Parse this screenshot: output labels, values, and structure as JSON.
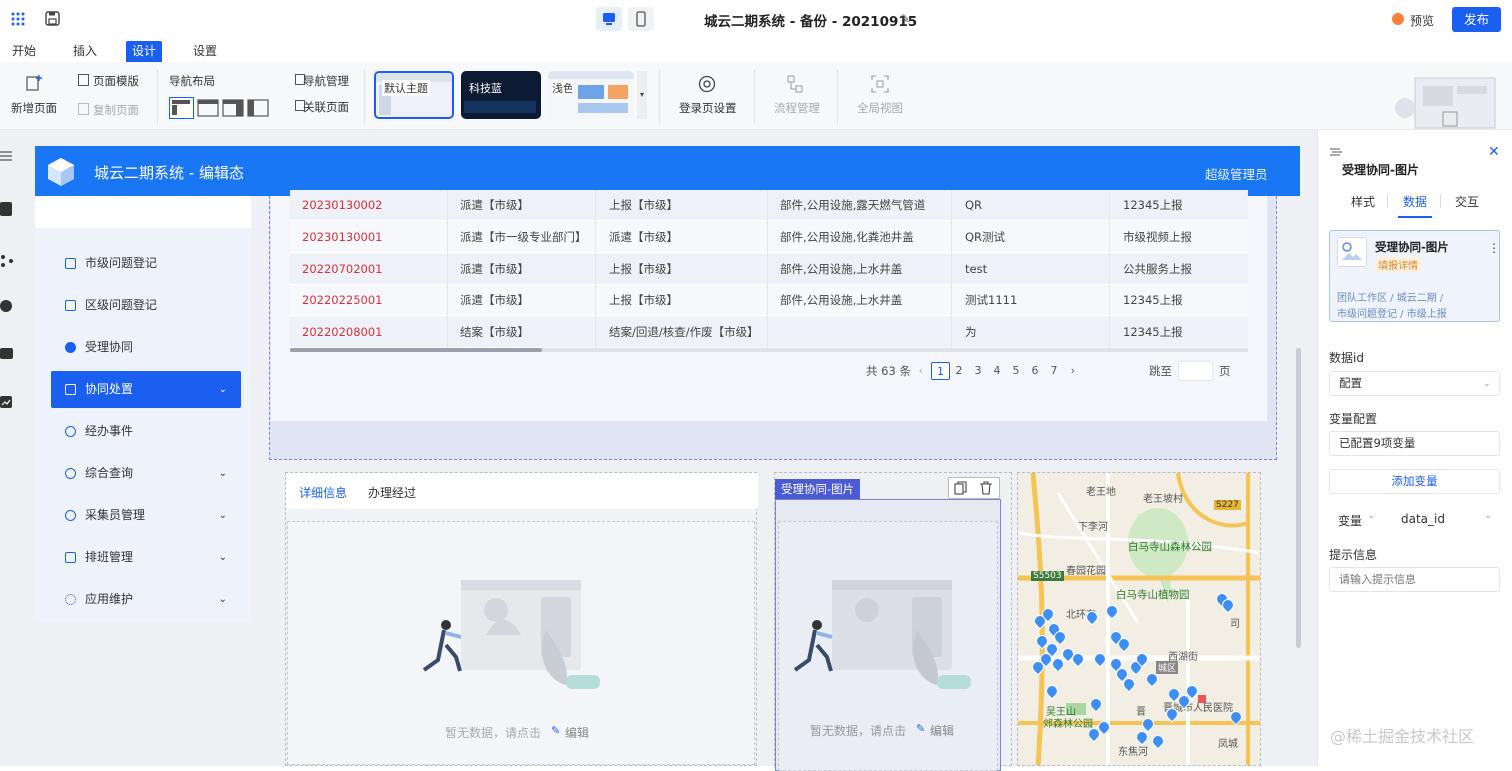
{
  "window": {
    "title": "城云二期系统 - 备份 - 20210915",
    "preview_label": "预览",
    "publish_label": "发布"
  },
  "menu": [
    "开始",
    "插入",
    "设计",
    "设置"
  ],
  "ribbon": {
    "new_page": "新增页面",
    "page_template": "页面模版",
    "copy_page": "复制页面",
    "nav_layout": "导航布局",
    "nav_manage": "导航管理",
    "linked_page": "关联页面",
    "themes": [
      "默认主题",
      "科技蓝",
      "浅色"
    ],
    "login_setting": "登录页设置",
    "flow_manage": "流程管理",
    "global_view": "全局视图"
  },
  "app": {
    "title": "城云二期系统 - 编辑态",
    "user": "超级管理员"
  },
  "nav": [
    {
      "label": "市级问题登记",
      "chev": ""
    },
    {
      "label": "区级问题登记",
      "chev": ""
    },
    {
      "label": "受理协同",
      "chev": ""
    },
    {
      "label": "协同处置",
      "chev": "⌄"
    },
    {
      "label": "经办事件",
      "chev": ""
    },
    {
      "label": "综合查询",
      "chev": "⌄"
    },
    {
      "label": "采集员管理",
      "chev": "⌄"
    },
    {
      "label": "排班管理",
      "chev": "⌄"
    },
    {
      "label": "应用维护",
      "chev": "⌄"
    }
  ],
  "table": {
    "rows": [
      [
        "20230130002",
        "派遣【市级】",
        "上报【市级】",
        "部件,公用设施,露天燃气管道",
        "QR",
        "12345上报"
      ],
      [
        "20230130001",
        "派遣【市一级专业部门】",
        "派遣【市级】",
        "部件,公用设施,化粪池井盖",
        "QR测试",
        "市级视频上报"
      ],
      [
        "20220702001",
        "派遣【市级】",
        "上报【市级】",
        "部件,公用设施,上水井盖",
        "test",
        "公共服务上报"
      ],
      [
        "20220225001",
        "派遣【市级】",
        "上报【市级】",
        "部件,公用设施,上水井盖",
        "测试1111",
        "12345上报"
      ],
      [
        "20220208001",
        "结案【市级】",
        "结案/回退/核查/作废【市级】",
        "",
        "为",
        "12345上报"
      ]
    ]
  },
  "pagination": {
    "total": "共 63 条",
    "pages": [
      "1",
      "2",
      "3",
      "4",
      "5",
      "6",
      "7"
    ],
    "current": "1",
    "goto": "跳至",
    "page_unit": "页",
    "prev": "‹",
    "next": "›"
  },
  "detail": {
    "tabs": [
      "详细信息",
      "办理经过"
    ],
    "empty": "暂无数据，请点击",
    "edit": "编辑"
  },
  "image_component": {
    "label": "受理协同-图片",
    "empty": "暂无数据，请点击",
    "edit": "编辑"
  },
  "map": {
    "labels": [
      "老王地",
      "老王坡村",
      "下李河",
      "白马寺山森林公园",
      "S227",
      "S5503",
      "春园花园",
      "白马寺山植物园",
      "北环东",
      "西湖街",
      "城区",
      "吴王山",
      "郊森林公园",
      "晋城市人民医院",
      "晋",
      "司",
      "东焦河",
      "凤城"
    ]
  },
  "right_panel": {
    "title": "受理协同-图片",
    "tabs": [
      "样式",
      "数据",
      "交互"
    ],
    "active_tab": "数据",
    "card_title": "受理协同-图片",
    "card_tag": "填报详情",
    "breadcrumb_1": "团队工作区 / 城云二期 /",
    "breadcrumb_2": "市级问题登记 / 市级上报",
    "data_id_label": "数据id",
    "data_id_value": "配置",
    "var_config_label": "变量配置",
    "var_config_value": "已配置9项变量",
    "add_var": "添加变量",
    "var_label": "变量",
    "var_value": "data_id",
    "hint_label": "提示信息",
    "hint_placeholder": "请输入提示信息"
  },
  "watermark": "@稀土掘金技术社区",
  "colors": {
    "accent": "#1a5ff0",
    "header": "#1976f5",
    "red": "#d9313b"
  }
}
